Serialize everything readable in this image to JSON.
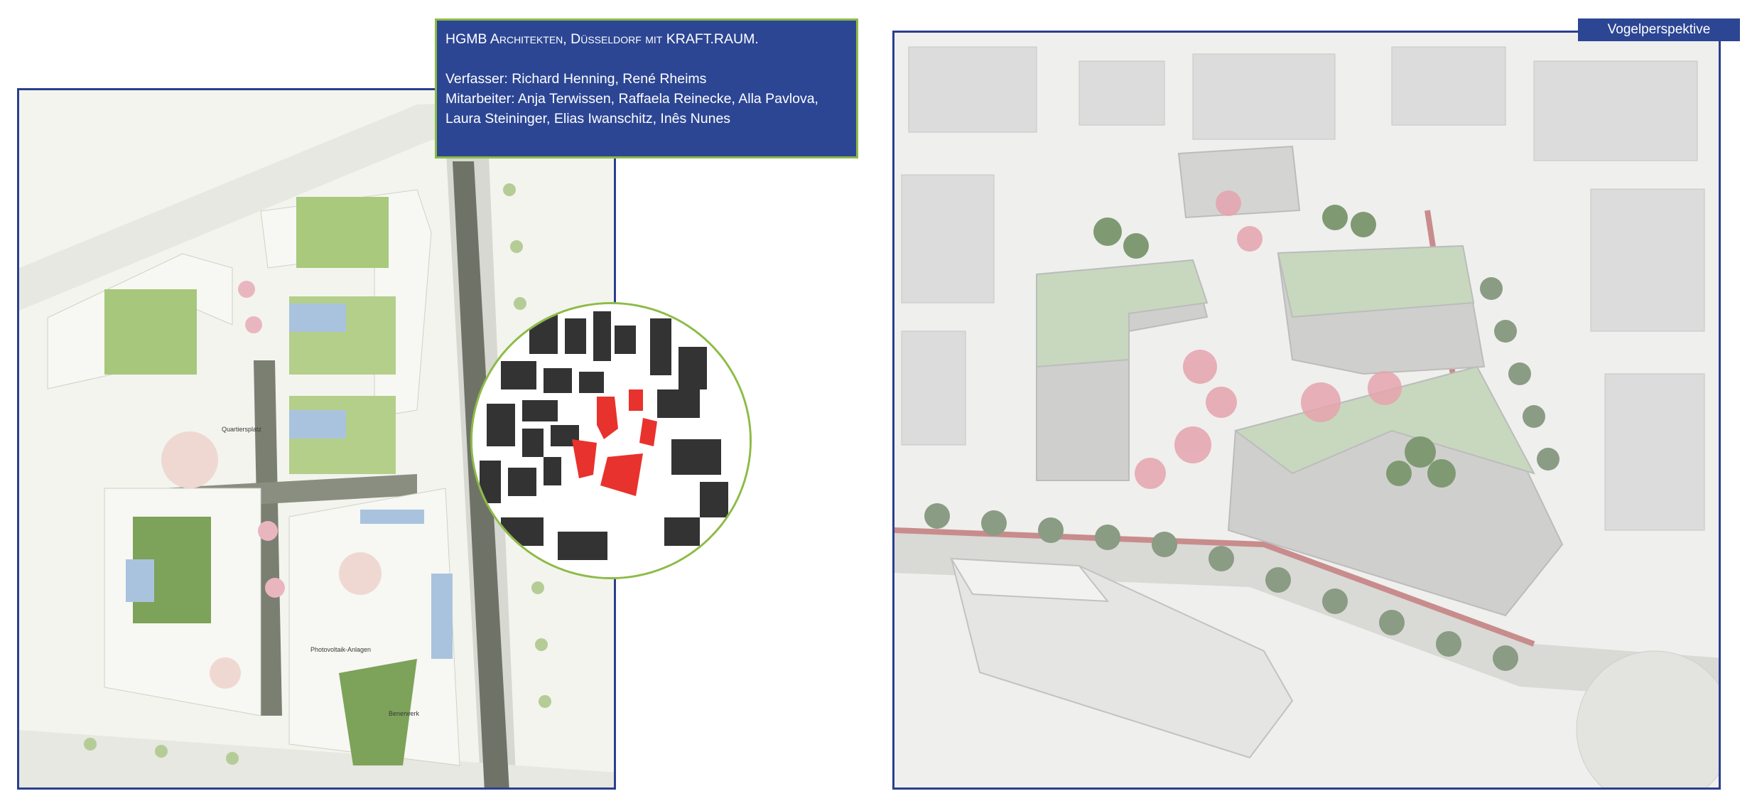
{
  "info_box": {
    "title": "HGMB Architekten, Düsseldorf mit KRAFT.RAUM.",
    "authors": "Verfasser: Richard Henning, René Rheims",
    "staff_line1": "Mitarbeiter: Anja Terwissen, Raffaela Reinecke, Alla Pavlova,",
    "staff_line2": "Laura Steininger, Elias Iwanschitz, Inês Nunes"
  },
  "aerial": {
    "label": "Vogelperspektive"
  },
  "colors": {
    "frame_blue": "#2b3f8f",
    "box_blue": "#2c4694",
    "box_green_border": "#8dbb45",
    "highlight_red": "#e8322d"
  },
  "icons": {
    "site_plan": "site-plan-image",
    "figure_ground": "figure-ground-map",
    "aerial": "aerial-rendering"
  }
}
